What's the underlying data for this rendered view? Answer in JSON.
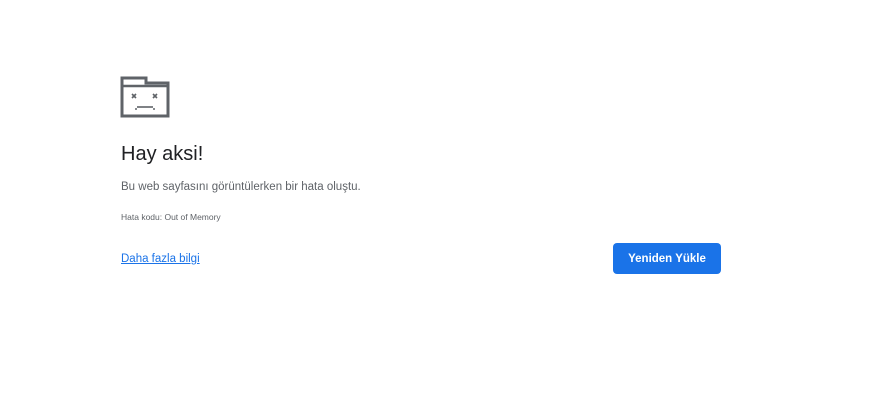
{
  "error_page": {
    "icon": "sad-tab-icon",
    "title": "Hay aksi!",
    "message": "Bu web sayfasını görüntülerken bir hata oluştu.",
    "error_code": "Hata kodu: Out of Memory",
    "learn_more_link": "Daha fazla bilgi",
    "reload_button": "Yeniden Yükle"
  },
  "colors": {
    "accent": "#1a73e8",
    "title_text": "#202124",
    "secondary_text": "#5f6368",
    "icon": "#5f6368",
    "background": "#ffffff"
  }
}
